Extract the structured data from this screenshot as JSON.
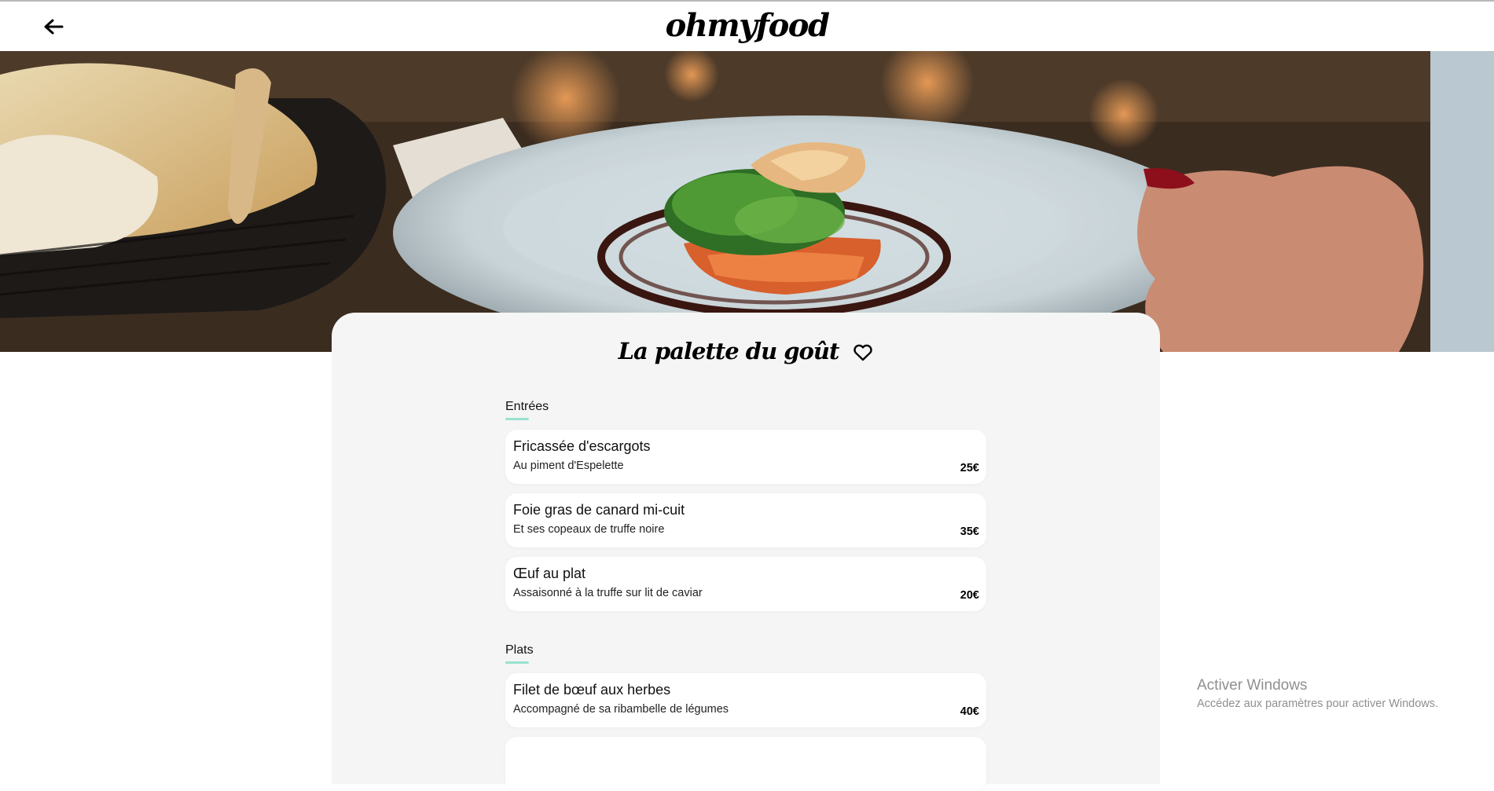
{
  "header": {
    "logo": "ohmyfood",
    "back_icon": "arrow-left-icon"
  },
  "hero": {
    "image": "plated fish dish with greens and sauce, bread basket on left, hand holding plate on right"
  },
  "restaurant": {
    "name": "La palette du goût",
    "favorite_icon": "heart-outline-icon"
  },
  "sections": [
    {
      "title": "Entrées",
      "dishes": [
        {
          "name": "Fricassée d'escargots",
          "description": "Au piment d'Espelette",
          "price": "25€"
        },
        {
          "name": "Foie gras de canard mi-cuit",
          "description": "Et ses copeaux de truffe noire",
          "price": "35€"
        },
        {
          "name": "Œuf au plat",
          "description": "Assaisonné à la truffe sur lit de caviar",
          "price": "20€"
        }
      ]
    },
    {
      "title": "Plats",
      "dishes": [
        {
          "name": "Filet de bœuf aux herbes",
          "description": "Accompagné de sa ribambelle de légumes",
          "price": "40€"
        },
        {
          "name": "",
          "description": "",
          "price": ""
        }
      ]
    }
  ],
  "watermark": {
    "title": "Activer Windows",
    "subtitle": "Accédez aux paramètres pour activer Windows."
  },
  "colors": {
    "accent": "#99e2d0",
    "card_bg": "#f5f5f5"
  }
}
